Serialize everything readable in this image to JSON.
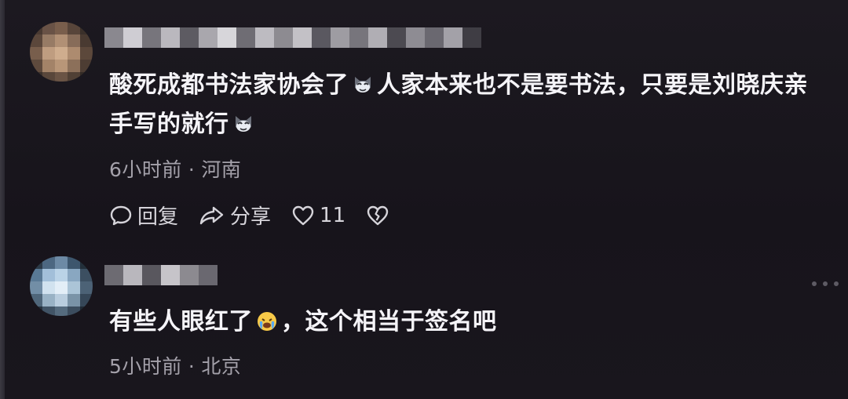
{
  "comments": [
    {
      "text_part1": "酸死成都书法家协会了",
      "text_part2": "人家本来也不是要书法，只要是刘晓庆亲手写的就行",
      "emoji_1": "cat-face-emoji",
      "emoji_2": "cat-face-emoji",
      "time": "6小时前",
      "separator": "·",
      "location": "河南",
      "reply_label": "回复",
      "share_label": "分享",
      "like_count": "11"
    },
    {
      "text_part1": "有些人眼红了",
      "text_part2": "，这个相当于签名吧",
      "emoji_1": "crying-face-emoji",
      "time": "5小时前",
      "separator": "·",
      "location": "北京"
    }
  ],
  "icons": {
    "reply": "comment-bubble-icon",
    "share": "share-arrow-icon",
    "like": "heart-icon",
    "dislike": "broken-heart-icon",
    "more": "more-dots-icon"
  },
  "colors": {
    "background": "#17141c",
    "text": "#f5f4f8",
    "meta": "#a4a1aa",
    "action": "#d6d4da"
  }
}
